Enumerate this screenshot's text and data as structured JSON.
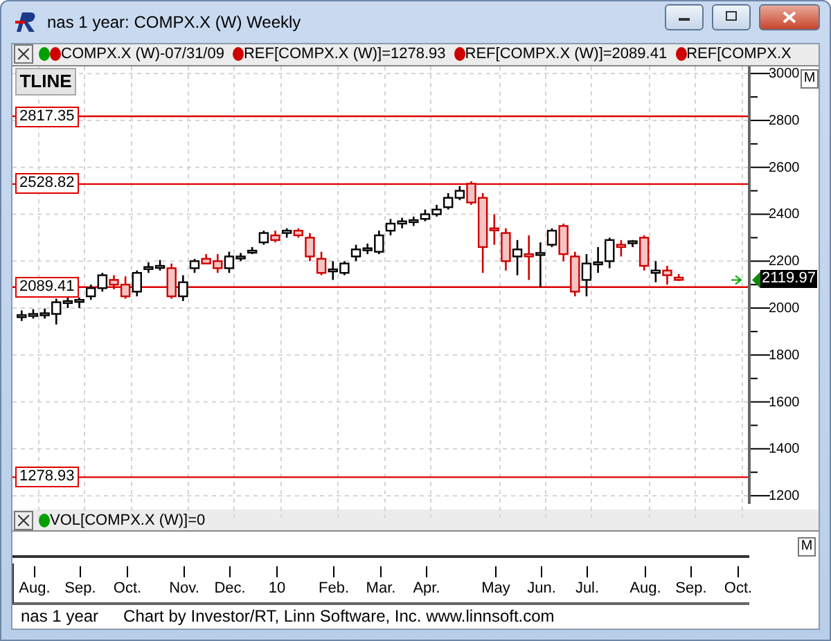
{
  "window": {
    "title": "nas 1 year: COMPX.X (W) Weekly"
  },
  "legend": {
    "items": [
      {
        "dots": [
          {
            "color": "#00a000"
          },
          {
            "color": "#d00000"
          }
        ],
        "text": "COMPX.X (W)-07/31/09"
      },
      {
        "dots": [
          {
            "color": "#d00000"
          }
        ],
        "text": "REF[COMPX.X (W)]=1278.93"
      },
      {
        "dots": [
          {
            "color": "#d00000"
          }
        ],
        "text": "REF[COMPX.X (W)]=2089.41"
      },
      {
        "dots": [
          {
            "color": "#d00000"
          }
        ],
        "text": "REF[COMPX.X"
      }
    ]
  },
  "tool_button": "TLINE",
  "price_axis": {
    "button": "M",
    "current_price": "2119.97"
  },
  "chart_data": {
    "type": "candlestick",
    "grid": true,
    "ylim": [
      1106,
      3030
    ],
    "yticks": [
      1200,
      1400,
      1600,
      1800,
      2000,
      2200,
      2400,
      2600,
      2800,
      3000
    ],
    "categories": [
      null,
      "Aug.",
      null,
      null,
      null,
      "Sep.",
      null,
      null,
      null,
      "Oct.",
      null,
      null,
      null,
      null,
      "Nov.",
      null,
      null,
      null,
      "Dec.",
      null,
      null,
      null,
      "10",
      null,
      null,
      null,
      null,
      "Feb.",
      null,
      null,
      null,
      "Mar.",
      null,
      null,
      null,
      "Apr.",
      null,
      null,
      null,
      null,
      null,
      "May",
      null,
      null,
      null,
      "Jun.",
      null,
      null,
      null,
      "Jul.",
      null,
      null,
      null,
      null,
      "Aug.",
      null,
      null,
      null,
      "Sep.",
      null,
      null,
      null,
      "Oct."
    ],
    "ref_lines": [
      {
        "axis": "y",
        "value": 2817.35,
        "label": "2817.35",
        "color": "#e00000"
      },
      {
        "axis": "y",
        "value": 2528.82,
        "label": "2528.82",
        "color": "#e00000"
      },
      {
        "axis": "y",
        "value": 2089.41,
        "label": "2089.41",
        "color": "#e00000"
      },
      {
        "axis": "y",
        "value": 1278.93,
        "label": "1278.93",
        "color": "#e00000"
      }
    ],
    "ohlc": [
      [
        1965,
        1990,
        1945,
        1970
      ],
      [
        1970,
        1995,
        1955,
        1975
      ],
      [
        1972,
        1998,
        1955,
        1978
      ],
      [
        1975,
        2040,
        1930,
        2025
      ],
      [
        2025,
        2045,
        2000,
        2030
      ],
      [
        2030,
        2045,
        2000,
        2035
      ],
      [
        2050,
        2100,
        2035,
        2085
      ],
      [
        2085,
        2150,
        2070,
        2140
      ],
      [
        2120,
        2140,
        2080,
        2100
      ],
      [
        2100,
        2135,
        2040,
        2050
      ],
      [
        2070,
        2160,
        2050,
        2150
      ],
      [
        2170,
        2195,
        2150,
        2175
      ],
      [
        2175,
        2205,
        2160,
        2180
      ],
      [
        2170,
        2190,
        2040,
        2050
      ],
      [
        2050,
        2140,
        2030,
        2110
      ],
      [
        2170,
        2210,
        2150,
        2200
      ],
      [
        2210,
        2230,
        2190,
        2190
      ],
      [
        2200,
        2230,
        2150,
        2170
      ],
      [
        2170,
        2240,
        2150,
        2220
      ],
      [
        2215,
        2235,
        2200,
        2220
      ],
      [
        2240,
        2260,
        2230,
        2245
      ],
      [
        2280,
        2330,
        2270,
        2320
      ],
      [
        2310,
        2330,
        2280,
        2290
      ],
      [
        2320,
        2340,
        2300,
        2330
      ],
      [
        2330,
        2340,
        2300,
        2310
      ],
      [
        2300,
        2320,
        2200,
        2220
      ],
      [
        2210,
        2240,
        2140,
        2150
      ],
      [
        2160,
        2200,
        2120,
        2165
      ],
      [
        2150,
        2200,
        2140,
        2190
      ],
      [
        2220,
        2270,
        2200,
        2250
      ],
      [
        2250,
        2275,
        2230,
        2255
      ],
      [
        2240,
        2330,
        2230,
        2310
      ],
      [
        2330,
        2380,
        2310,
        2360
      ],
      [
        2360,
        2385,
        2340,
        2370
      ],
      [
        2370,
        2390,
        2350,
        2375
      ],
      [
        2380,
        2420,
        2370,
        2400
      ],
      [
        2400,
        2440,
        2390,
        2420
      ],
      [
        2430,
        2490,
        2420,
        2470
      ],
      [
        2470,
        2520,
        2460,
        2500
      ],
      [
        2530,
        2540,
        2440,
        2450
      ],
      [
        2470,
        2490,
        2150,
        2260
      ],
      [
        2340,
        2400,
        2270,
        2335
      ],
      [
        2320,
        2340,
        2160,
        2200
      ],
      [
        2220,
        2290,
        2140,
        2250
      ],
      [
        2230,
        2310,
        2120,
        2220
      ],
      [
        2230,
        2280,
        2090,
        2235
      ],
      [
        2270,
        2340,
        2260,
        2330
      ],
      [
        2350,
        2360,
        2200,
        2230
      ],
      [
        2220,
        2240,
        2050,
        2070
      ],
      [
        2120,
        2230,
        2050,
        2190
      ],
      [
        2190,
        2260,
        2150,
        2195
      ],
      [
        2200,
        2300,
        2170,
        2290
      ],
      [
        2270,
        2290,
        2220,
        2260
      ],
      [
        2280,
        2290,
        2260,
        2285
      ],
      [
        2300,
        2310,
        2160,
        2180
      ],
      [
        2150,
        2200,
        2110,
        2160
      ],
      [
        2160,
        2180,
        2100,
        2140
      ],
      [
        2130,
        2145,
        2115,
        2120
      ],
      null,
      null,
      null,
      null,
      null
    ]
  },
  "volume": {
    "dots": [
      {
        "color": "#00a000"
      }
    ],
    "text": "VOL[COMPX.X (W)]=0",
    "button": "M"
  },
  "status_bar": {
    "name": "nas 1 year",
    "credit": "Chart by Investor/RT, Linn Software, Inc. www.linnsoft.com"
  }
}
